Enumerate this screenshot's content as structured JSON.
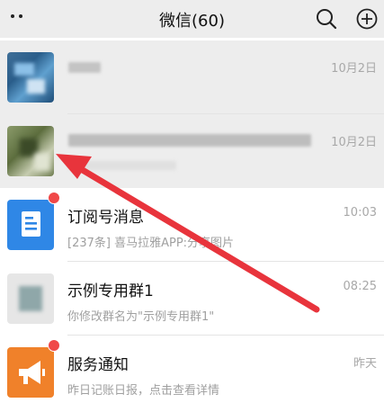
{
  "header": {
    "title": "微信(60)"
  },
  "chats": [
    {
      "name": "",
      "preview": "",
      "time": "10月2日"
    },
    {
      "name": "",
      "preview": "",
      "time": "10月2日"
    },
    {
      "name": "订阅号消息",
      "preview": "[237条] 喜马拉雅APP:分享图片",
      "time": "10:03"
    },
    {
      "name": "示例专用群1",
      "preview": "你修改群名为\"示例专用群1\"",
      "time": "08:25"
    },
    {
      "name": "服务通知",
      "preview": "昨日记账日报，点击查看详情",
      "time": "昨天"
    }
  ],
  "colors": {
    "arrow": "#e8343c",
    "unread_dot": "#f04848",
    "subscription_blue": "#2f87e6",
    "service_orange": "#f0812a"
  }
}
